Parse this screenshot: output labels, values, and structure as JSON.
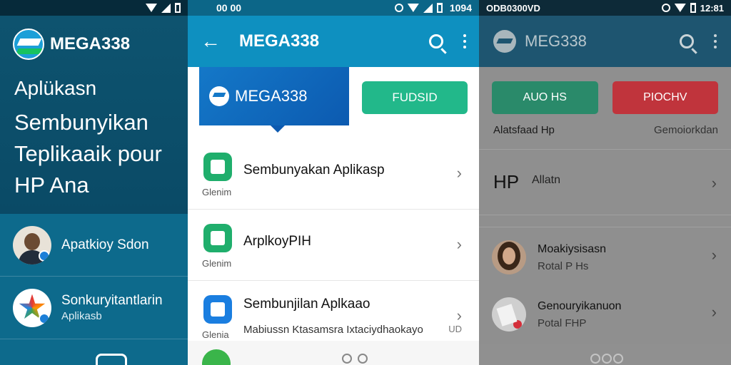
{
  "panel1": {
    "brand": "MEGA338",
    "headline_line1": "Aplükasn",
    "headline_line2": "Sembunyikan",
    "headline_line3": "Teplikaaik pour",
    "headline_line4": "HP Ana",
    "items": [
      {
        "title": "Apatkioy Sdon",
        "subtitle": ""
      },
      {
        "title": "Sonkuryitantlarin",
        "subtitle": "Aplikasb"
      }
    ]
  },
  "panel2": {
    "status_time": "1094",
    "status_left": "00 00",
    "title": "MEGA338",
    "brand_box": "MEGA338",
    "action_label": "FUDSID",
    "items": [
      {
        "title": "Sembunyakan Aplikasp",
        "category": "Glenim",
        "desc": "",
        "extra": ""
      },
      {
        "title": "ArplkoyPIH",
        "category": "Glenim",
        "desc": "",
        "extra": ""
      },
      {
        "title": "Sembunjilan Aplkaao",
        "category": "Glenia",
        "desc": "Mabiussn Ktasamsra Ixtaciydhaokayo",
        "extra": "UD"
      }
    ]
  },
  "panel3": {
    "status_left": "ODB0300VD",
    "status_time": "12:81",
    "title": "MEG338",
    "btn_green": "AUO HS",
    "btn_red": "PIOCHV",
    "row1_left": "Alatsfaad Hp",
    "row1_right": "Gemoiorkdan",
    "hp_big": "HP",
    "hp_label": "Allatn",
    "items": [
      {
        "title": "Moakiysisasn",
        "subtitle": "Rotal P Hs"
      },
      {
        "title": "Genouryikanuon",
        "subtitle": "Potal FHP"
      }
    ]
  },
  "colors": {
    "panel1_bg": "#0e5470",
    "panel2_appbar": "#0e90c0",
    "action_green": "#22b88a",
    "panel3_btn_red": "#c0343c"
  }
}
